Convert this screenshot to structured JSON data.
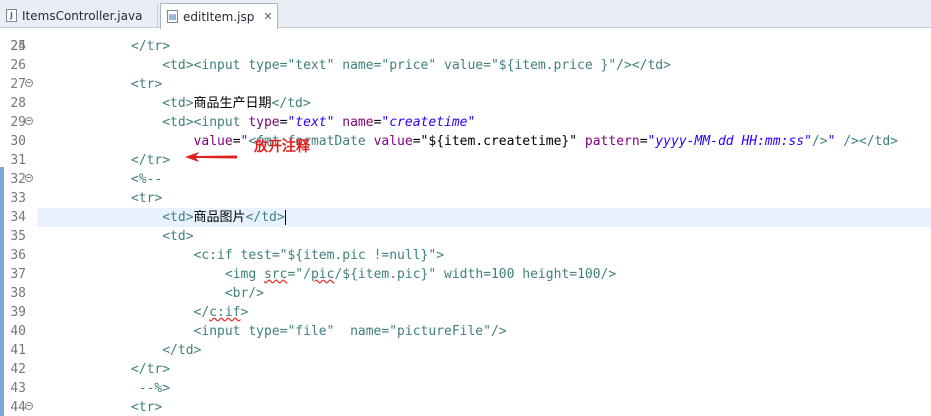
{
  "tabs": [
    {
      "label": "ItemsController.java",
      "icon": "java-file-icon",
      "icon_glyph": "J",
      "active": false
    },
    {
      "label": "editItem.jsp",
      "icon": "jsp-file-icon",
      "icon_glyph": "▤",
      "active": true,
      "close": "✕"
    }
  ],
  "colors": {
    "tag": "#3f7f7f",
    "attr": "#7f007f",
    "value": "#2a00ff",
    "annotation": "#e02020",
    "current_line": "#e8f2fe"
  },
  "annotation": {
    "text": "放开注释",
    "icon": "red-arrow-icon"
  },
  "lines": [
    {
      "n": "25",
      "tokens": [
        [
          "plain",
          "            "
        ],
        [
          "t",
          "</tr>"
        ]
      ]
    },
    {
      "n": "26",
      "tokens": [
        [
          "plain",
          ""
        ]
      ]
    },
    {
      "n": "27",
      "fold": true,
      "tokens": [
        [
          "plain",
          "            "
        ],
        [
          "t",
          "<tr>"
        ]
      ]
    },
    {
      "n": "28",
      "tokens": [
        [
          "plain",
          "                "
        ],
        [
          "t",
          "<td>"
        ],
        [
          "plain",
          "商品生产日期"
        ],
        [
          "t",
          "</td>"
        ]
      ]
    },
    {
      "n": "29",
      "fold": true,
      "tokens": [
        [
          "plain",
          "                "
        ],
        [
          "t",
          "<td><input "
        ],
        [
          "a",
          "type"
        ],
        [
          "plain",
          "="
        ],
        [
          "v",
          "\"text\""
        ],
        [
          "plain",
          " "
        ],
        [
          "a",
          "name"
        ],
        [
          "plain",
          "="
        ],
        [
          "v",
          "\"createtime\""
        ]
      ]
    },
    {
      "n": "30",
      "tokens": [
        [
          "plain",
          "                    "
        ],
        [
          "a",
          "value"
        ],
        [
          "plain",
          "="
        ],
        [
          "v",
          "\""
        ],
        [
          "t",
          "<fmt:formatDate "
        ],
        [
          "a",
          "value"
        ],
        [
          "plain",
          "=\"${item.createtime}\" "
        ],
        [
          "a",
          "pattern"
        ],
        [
          "plain",
          "="
        ],
        [
          "v",
          "\"yyyy-MM-dd HH:mm:ss\""
        ],
        [
          "t",
          "/>"
        ],
        [
          "v",
          "\""
        ],
        [
          "plain",
          " "
        ],
        [
          "t",
          "/></td>"
        ]
      ]
    },
    {
      "n": "31",
      "tokens": [
        [
          "plain",
          "            "
        ],
        [
          "t",
          "</tr>"
        ]
      ]
    },
    {
      "n": "32",
      "fold": true,
      "tokens": [
        [
          "plain",
          "            "
        ],
        [
          "t",
          "<%--"
        ]
      ]
    },
    {
      "n": "33",
      "tokens": [
        [
          "plain",
          "            "
        ],
        [
          "t",
          "<tr>"
        ]
      ]
    },
    {
      "n": "34",
      "current": true,
      "tokens": [
        [
          "plain",
          "                "
        ],
        [
          "t",
          "<td>"
        ],
        [
          "plain",
          "商品图片"
        ],
        [
          "t",
          "</td>"
        ],
        [
          "caret",
          ""
        ]
      ]
    },
    {
      "n": "35",
      "tokens": [
        [
          "plain",
          "                "
        ],
        [
          "t",
          "<td>"
        ]
      ]
    },
    {
      "n": "36",
      "tokens": [
        [
          "plain",
          "                    "
        ],
        [
          "t",
          "<c:if "
        ],
        [
          "t",
          "test"
        ],
        [
          "t",
          "=\"${item.pic !=null}\">"
        ]
      ]
    },
    {
      "n": "37",
      "tokens": [
        [
          "plain",
          "                        "
        ],
        [
          "t",
          "<img "
        ],
        [
          "t",
          "sq:src"
        ],
        [
          "t",
          "=\"/"
        ],
        [
          "t",
          "sq:pic"
        ],
        [
          "t",
          "/${item.pic}\" width=100 height=100/>"
        ]
      ]
    },
    {
      "n": "38",
      "tokens": [
        [
          "plain",
          "                        "
        ],
        [
          "t",
          "<br/>"
        ]
      ]
    },
    {
      "n": "39",
      "tokens": [
        [
          "plain",
          "                    "
        ],
        [
          "t",
          "</"
        ],
        [
          "t",
          "sq:c:if"
        ],
        [
          "t",
          ">"
        ]
      ]
    },
    {
      "n": "40",
      "tokens": [
        [
          "plain",
          "                    "
        ],
        [
          "t",
          "<input type=\"file\"  name=\"pictureFile\"/>"
        ]
      ]
    },
    {
      "n": "41",
      "tokens": [
        [
          "plain",
          "                "
        ],
        [
          "t",
          "</td>"
        ]
      ]
    },
    {
      "n": "42",
      "tokens": [
        [
          "plain",
          "            "
        ],
        [
          "t",
          "</tr>"
        ]
      ]
    },
    {
      "n": "43",
      "tokens": [
        [
          "plain",
          "             "
        ],
        [
          "t",
          "--%>"
        ]
      ]
    },
    {
      "n": "44",
      "fold": true,
      "tokens": [
        [
          "plain",
          "            "
        ],
        [
          "t",
          "<tr>"
        ]
      ]
    }
  ],
  "top_partial": "                <td><input type=\"text\" name=\"price\" value=\"${item.price }\"/></td>"
}
